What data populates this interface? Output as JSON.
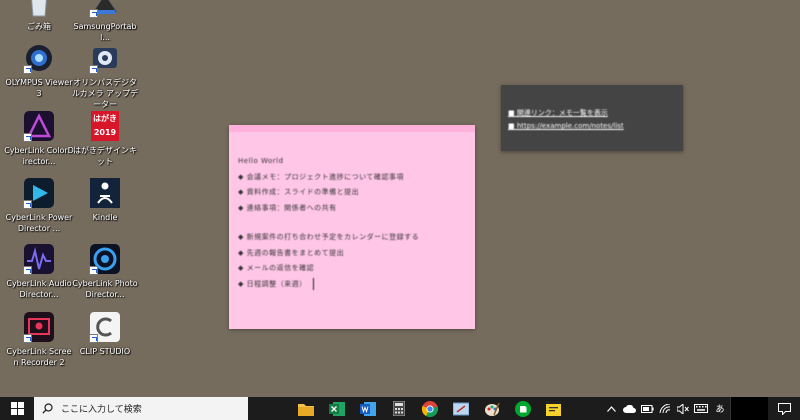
{
  "desktop": {
    "icons": [
      {
        "name": "recycle-bin",
        "label": "ごみ箱"
      },
      {
        "name": "samsung-portable",
        "label": "SamsungPortabl..."
      },
      {
        "name": "olympus-viewer",
        "label": "OLYMPUS Viewer 3"
      },
      {
        "name": "olympus-updater",
        "label": "オリンパスデジタルカメラ アップデーター"
      },
      {
        "name": "cyberlink-colordirector",
        "label": "CyberLink ColorDirector..."
      },
      {
        "name": "hagaki-design-kit",
        "label": "はがきデザインキット"
      },
      {
        "name": "cyberlink-powerdirector",
        "label": "CyberLink PowerDirector ..."
      },
      {
        "name": "kindle",
        "label": "Kindle"
      },
      {
        "name": "cyberlink-audiodirector",
        "label": "CyberLink AudioDirector..."
      },
      {
        "name": "cyberlink-photodirector",
        "label": "CyberLink PhotoDirector..."
      },
      {
        "name": "cyberlink-screen-recorder",
        "label": "CyberLink Screen Recorder 2"
      },
      {
        "name": "clip-studio",
        "label": "CLIP STUDIO"
      }
    ],
    "hagaki_badge": {
      "top": "はがき",
      "year": "2019"
    }
  },
  "sticky_note": {
    "color": "#ffc6e8",
    "lines": [
      "Hello World",
      "◆ 会議メモ：プロジェクト進捗について確認事項",
      "◆ 資料作成：スライドの準備と提出",
      "◆ 連絡事項：関係者への共有",
      "",
      "◆ 新規案件の打ち合わせ予定をカレンダーに登録する",
      "◆ 先週の報告書をまとめて提出",
      "◆ メールの返信を確認",
      "◆ 日程調整（来週）"
    ]
  },
  "popup_note": {
    "lines": [
      "■ 関連リンク：メモ一覧を表示",
      "■ https://example.com/notes/list"
    ]
  },
  "taskbar": {
    "search_placeholder": "ここに入力して検索",
    "apps": [
      "file-explorer",
      "excel",
      "word",
      "calculator",
      "chrome",
      "snipping",
      "paint",
      "evernote",
      "sticky-notes"
    ],
    "tray": {
      "ime": "あ"
    }
  }
}
